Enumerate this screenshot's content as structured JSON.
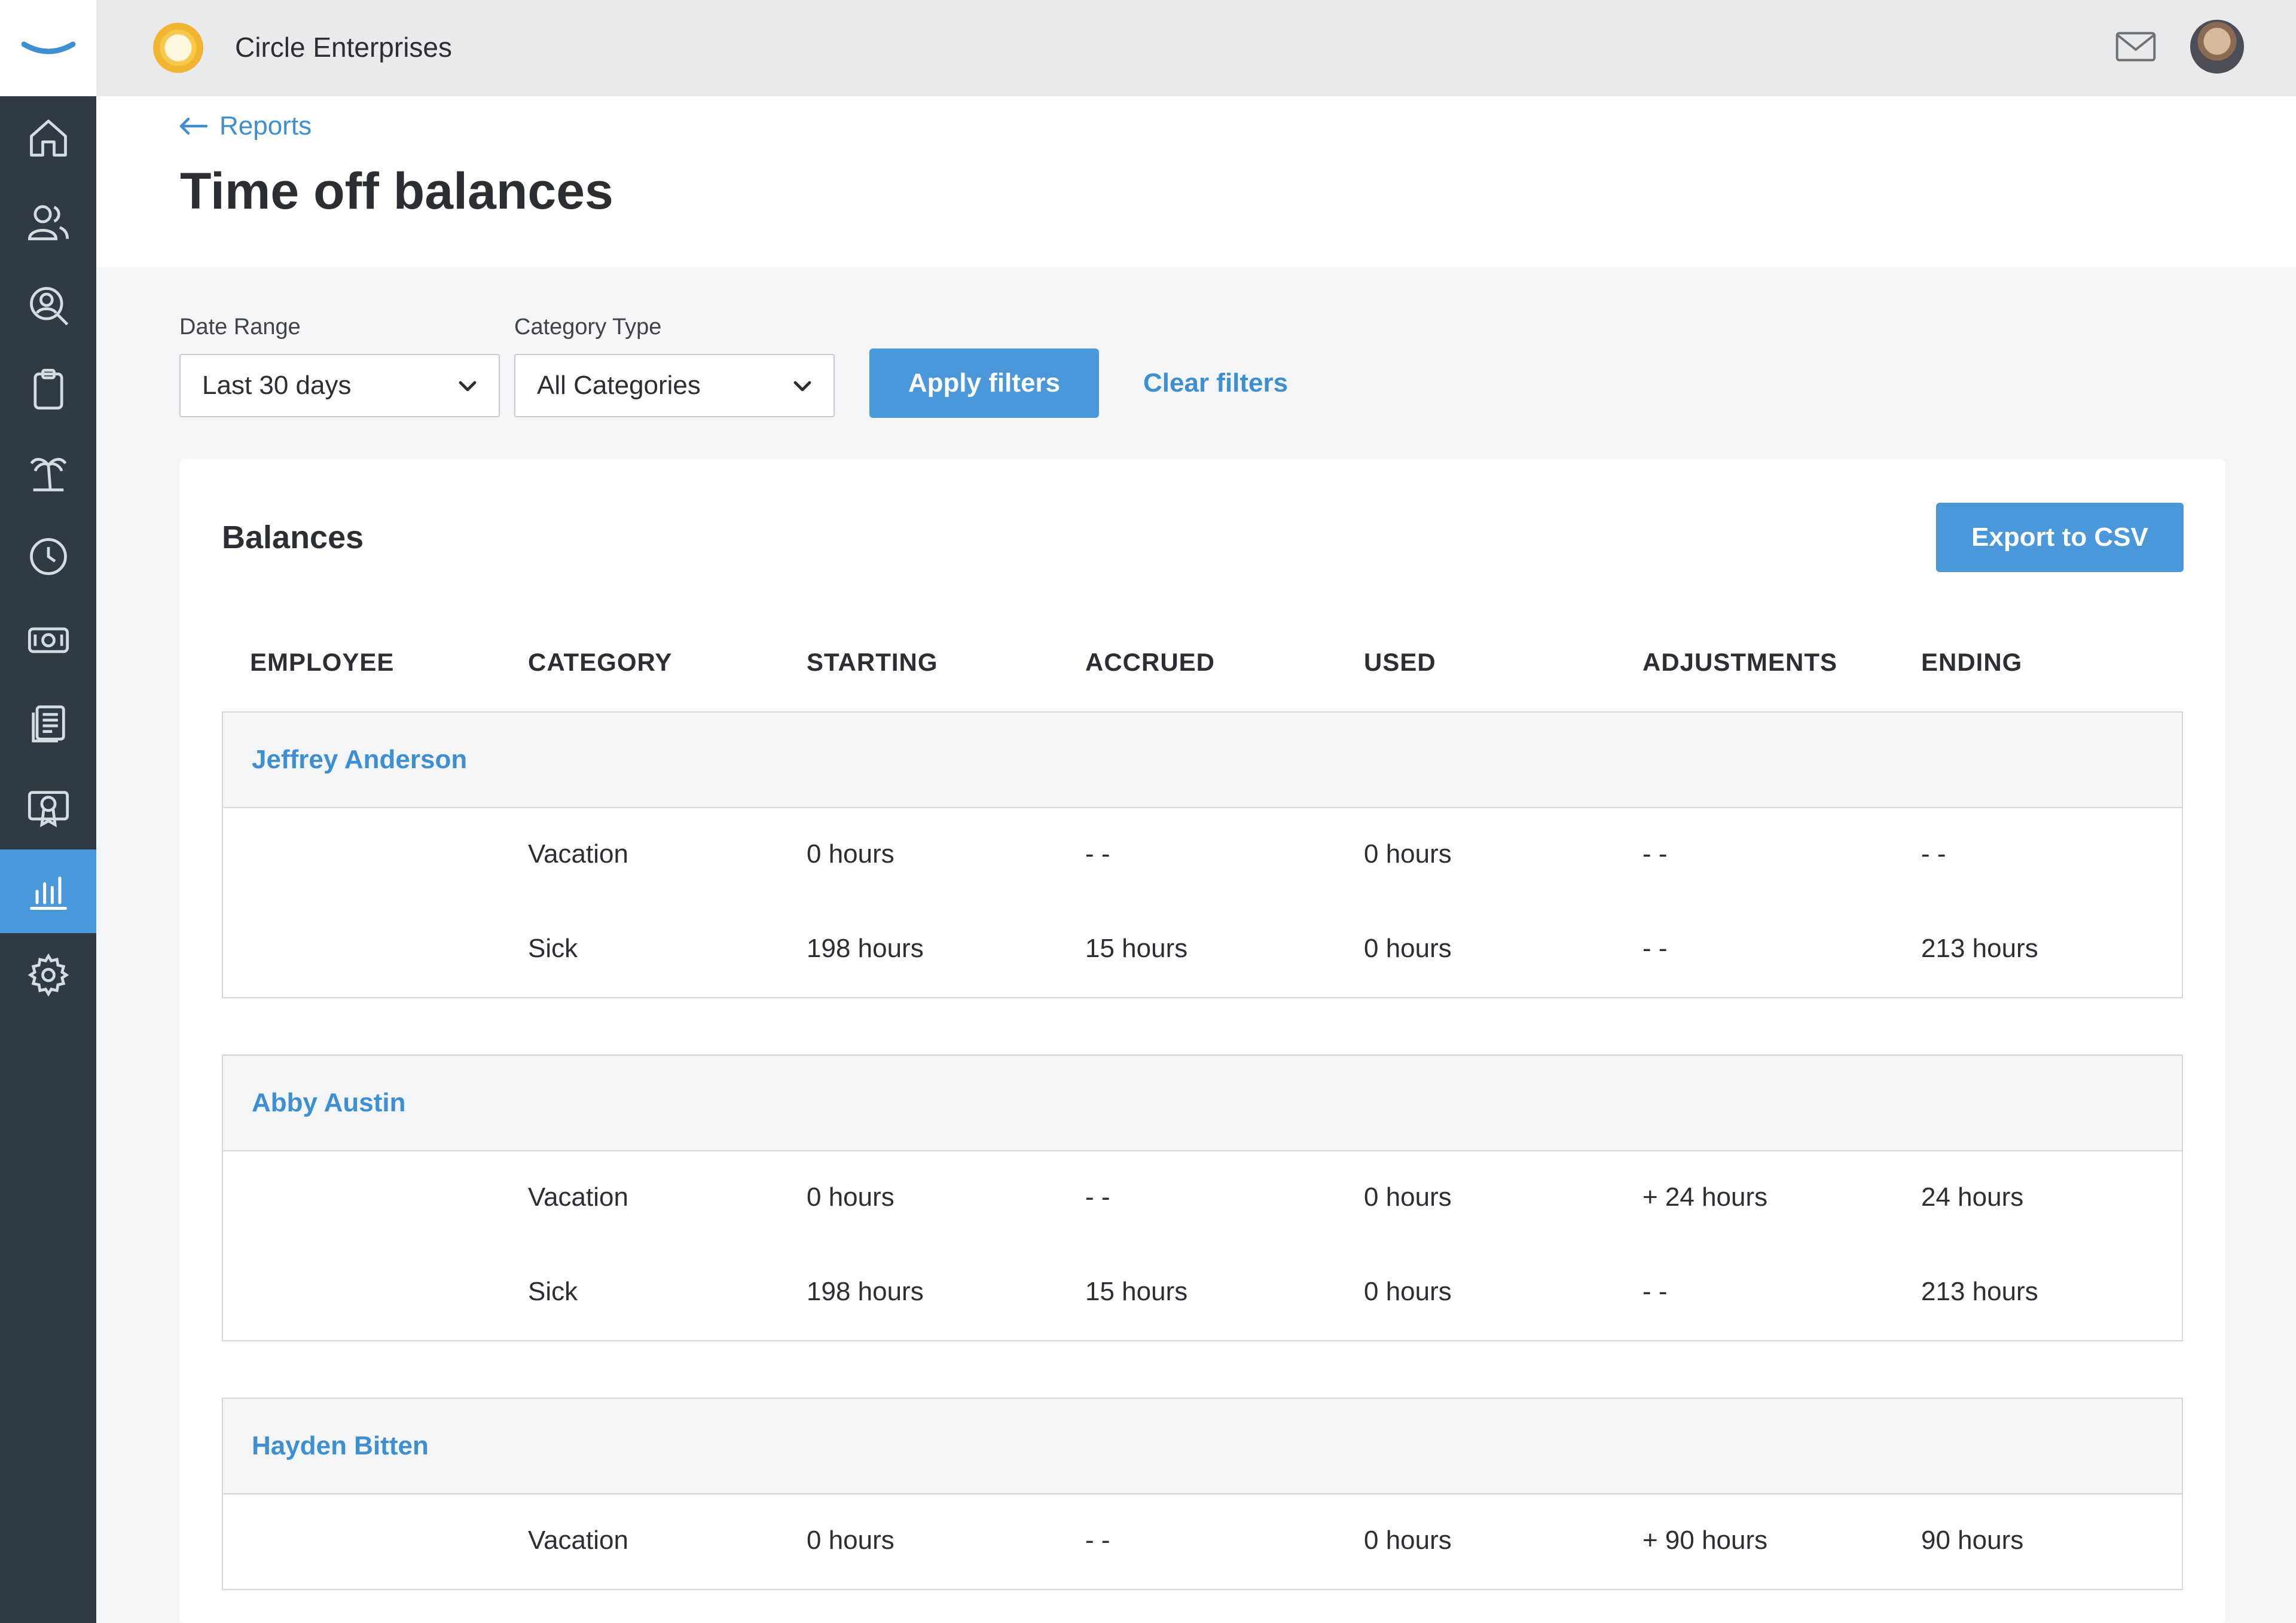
{
  "topbar": {
    "organization": "Circle Enterprises",
    "mail_icon": "mail-icon",
    "avatar_icon": "avatar"
  },
  "sidebar": {
    "items": [
      {
        "icon": "home-icon"
      },
      {
        "icon": "people-icon"
      },
      {
        "icon": "user-search-icon"
      },
      {
        "icon": "clipboard-icon"
      },
      {
        "icon": "palm-tree-icon"
      },
      {
        "icon": "clock-icon"
      },
      {
        "icon": "money-icon"
      },
      {
        "icon": "documents-icon"
      },
      {
        "icon": "certificate-icon"
      },
      {
        "icon": "reports-chart-icon",
        "active": true
      },
      {
        "icon": "gear-icon"
      }
    ],
    "accent": "#4a98d9"
  },
  "header": {
    "back_label": "Reports",
    "title": "Time off balances"
  },
  "filters": {
    "date_range_label": "Date Range",
    "date_range_value": "Last 30 days",
    "category_type_label": "Category Type",
    "category_type_value": "All Categories",
    "apply_label": "Apply filters",
    "clear_label": "Clear filters"
  },
  "balances": {
    "title": "Balances",
    "export_label": "Export to CSV",
    "columns": [
      "EMPLOYEE",
      "CATEGORY",
      "STARTING",
      "ACCRUED",
      "USED",
      "ADJUSTMENTS",
      "ENDING"
    ],
    "employees": [
      {
        "name": "Jeffrey Anderson",
        "rows": [
          {
            "category": "Vacation",
            "starting": "0 hours",
            "accrued": "- -",
            "used": "0 hours",
            "adjustments": "- -",
            "ending": "- -"
          },
          {
            "category": "Sick",
            "starting": "198 hours",
            "accrued": "15 hours",
            "used": "0 hours",
            "adjustments": "- -",
            "ending": "213 hours"
          }
        ]
      },
      {
        "name": "Abby Austin",
        "rows": [
          {
            "category": "Vacation",
            "starting": "0 hours",
            "accrued": "- -",
            "used": "0 hours",
            "adjustments": "+ 24 hours",
            "ending": "24 hours"
          },
          {
            "category": "Sick",
            "starting": "198 hours",
            "accrued": "15 hours",
            "used": "0 hours",
            "adjustments": "- -",
            "ending": "213 hours"
          }
        ]
      },
      {
        "name": "Hayden Bitten",
        "rows": [
          {
            "category": "Vacation",
            "starting": "0 hours",
            "accrued": "- -",
            "used": "0 hours",
            "adjustments": "+ 90 hours",
            "ending": "90 hours"
          }
        ]
      }
    ]
  }
}
